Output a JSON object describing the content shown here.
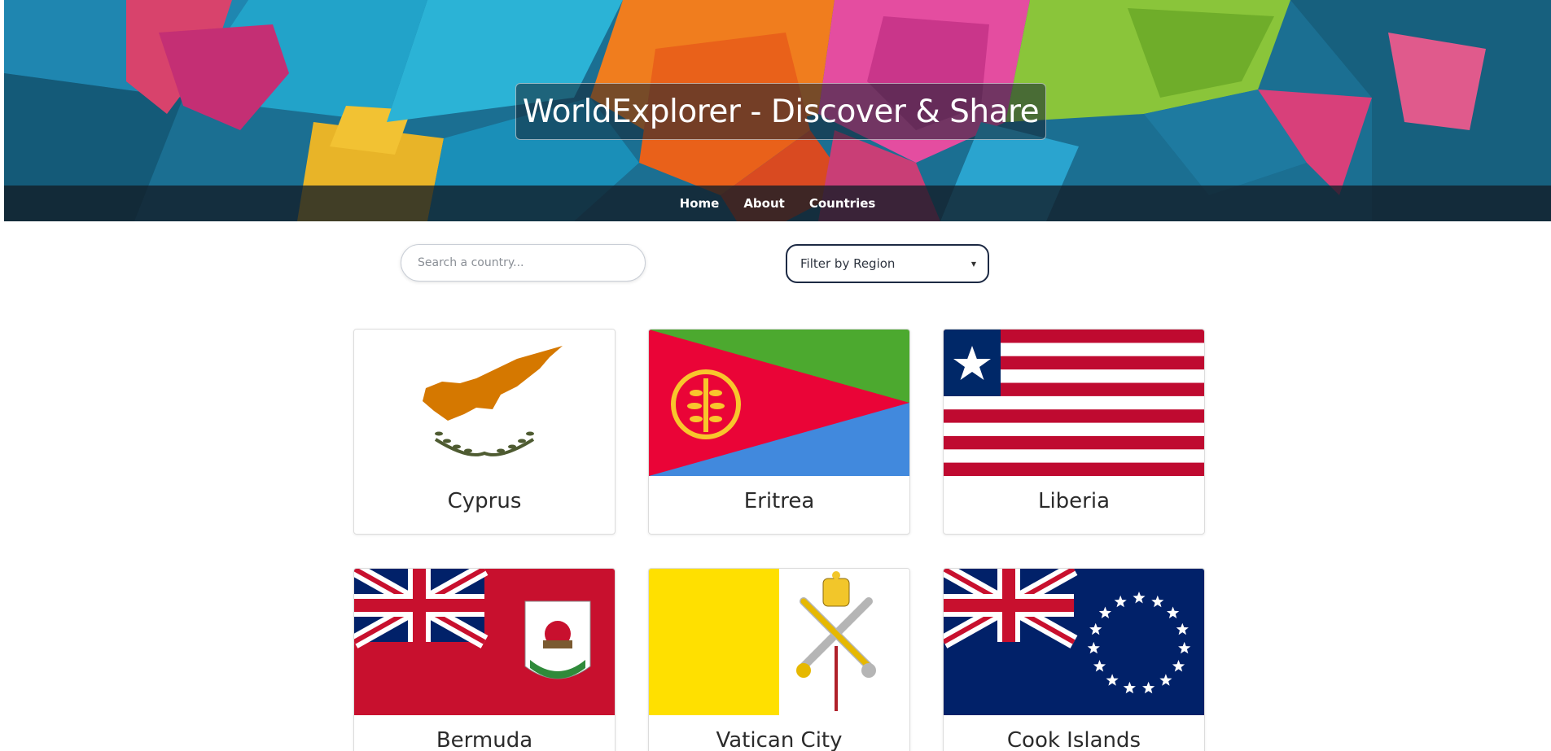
{
  "header": {
    "title": "WorldExplorer - Discover & Share",
    "nav": [
      "Home",
      "About",
      "Countries"
    ]
  },
  "controls": {
    "search_placeholder": "Search a country...",
    "filter_label": "Filter by Region"
  },
  "countries": [
    {
      "name": "Cyprus",
      "flag": "cyprus-flag"
    },
    {
      "name": "Eritrea",
      "flag": "eritrea-flag"
    },
    {
      "name": "Liberia",
      "flag": "liberia-flag"
    },
    {
      "name": "Bermuda",
      "flag": "bermuda-flag"
    },
    {
      "name": "Vatican City",
      "flag": "vatican-city-flag"
    },
    {
      "name": "Cook Islands",
      "flag": "cook-islands-flag"
    }
  ],
  "colors": {
    "nav_bar": "#121c26",
    "filter_border": "#1d2a44",
    "card_text": "#2b2b2b"
  }
}
